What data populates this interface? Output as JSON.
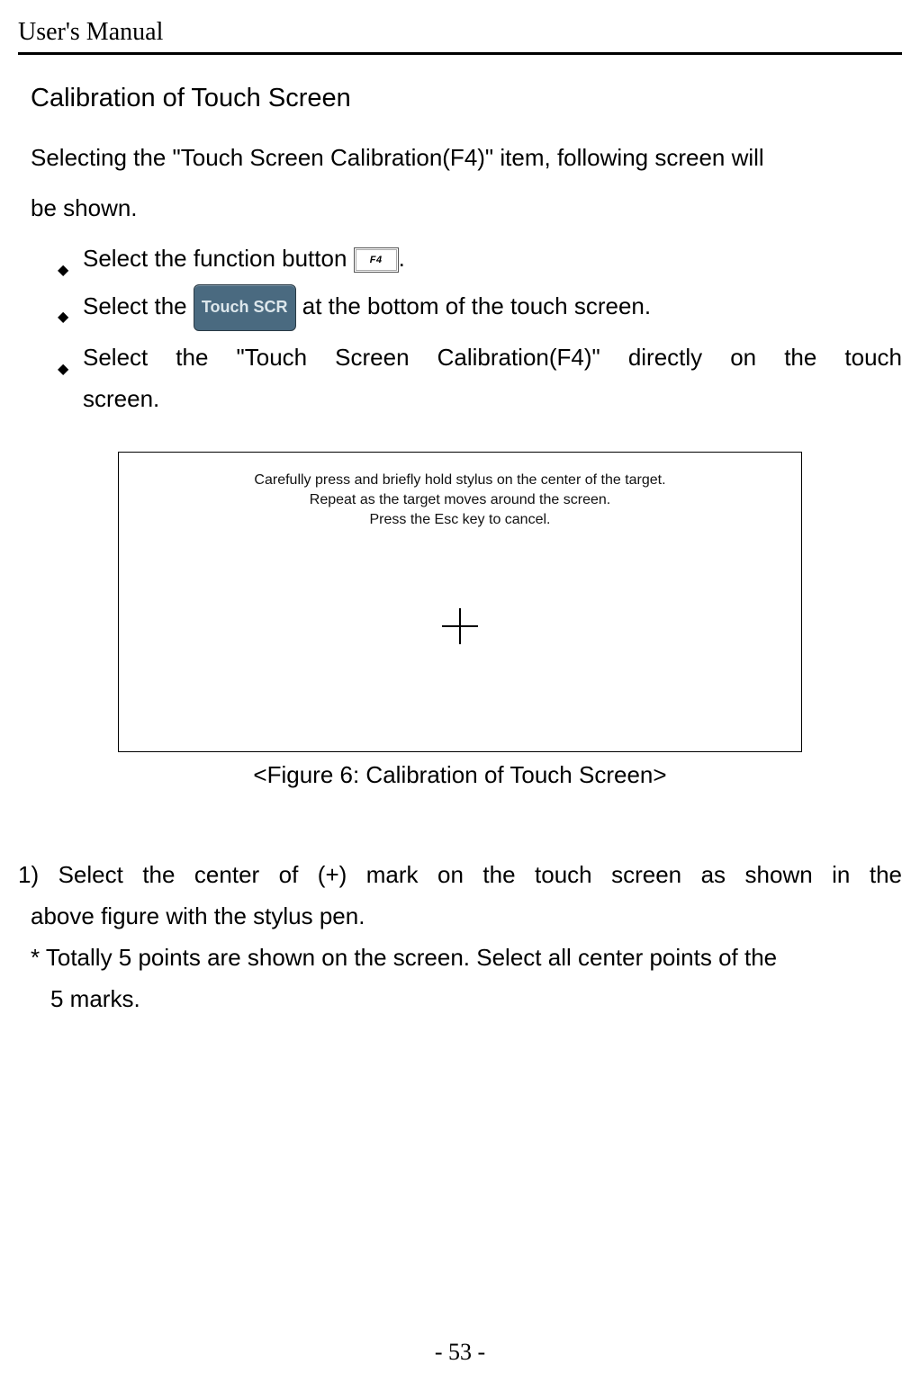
{
  "header": {
    "title": "User's Manual"
  },
  "section": {
    "title": "Calibration of Touch Screen",
    "intro_part1": "Selecting the \"Touch Screen Calibration(F4)\" item, following screen will",
    "intro_part2": "be shown.",
    "bullets": {
      "b1_pre": "Select the function button ",
      "b1_post": ".",
      "f4_label": "F4",
      "b2_pre": "Select the ",
      "touch_scr_label": "Touch SCR",
      "b2_post": " at the bottom of the touch screen.",
      "b3_line1_pre": "Select the \"Touch Screen Calibration(F4)\" directly on the touch",
      "b3_line2": "screen."
    }
  },
  "figure": {
    "line1": "Carefully press and briefly hold stylus on the center of the target.",
    "line2": "Repeat as the target moves around the screen.",
    "line3": "Press the Esc key to cancel.",
    "caption": "<Figure 6: Calibration of Touch Screen>"
  },
  "steps": {
    "s1_line1": "1) Select the center of (+) mark on the touch screen as shown in the",
    "s1_line2": "above figure with the stylus pen.",
    "note_line1": "* Totally 5 points are shown on the screen. Select all center points of the",
    "note_line2": "5 marks."
  },
  "footer": {
    "page": "- 53 -"
  }
}
